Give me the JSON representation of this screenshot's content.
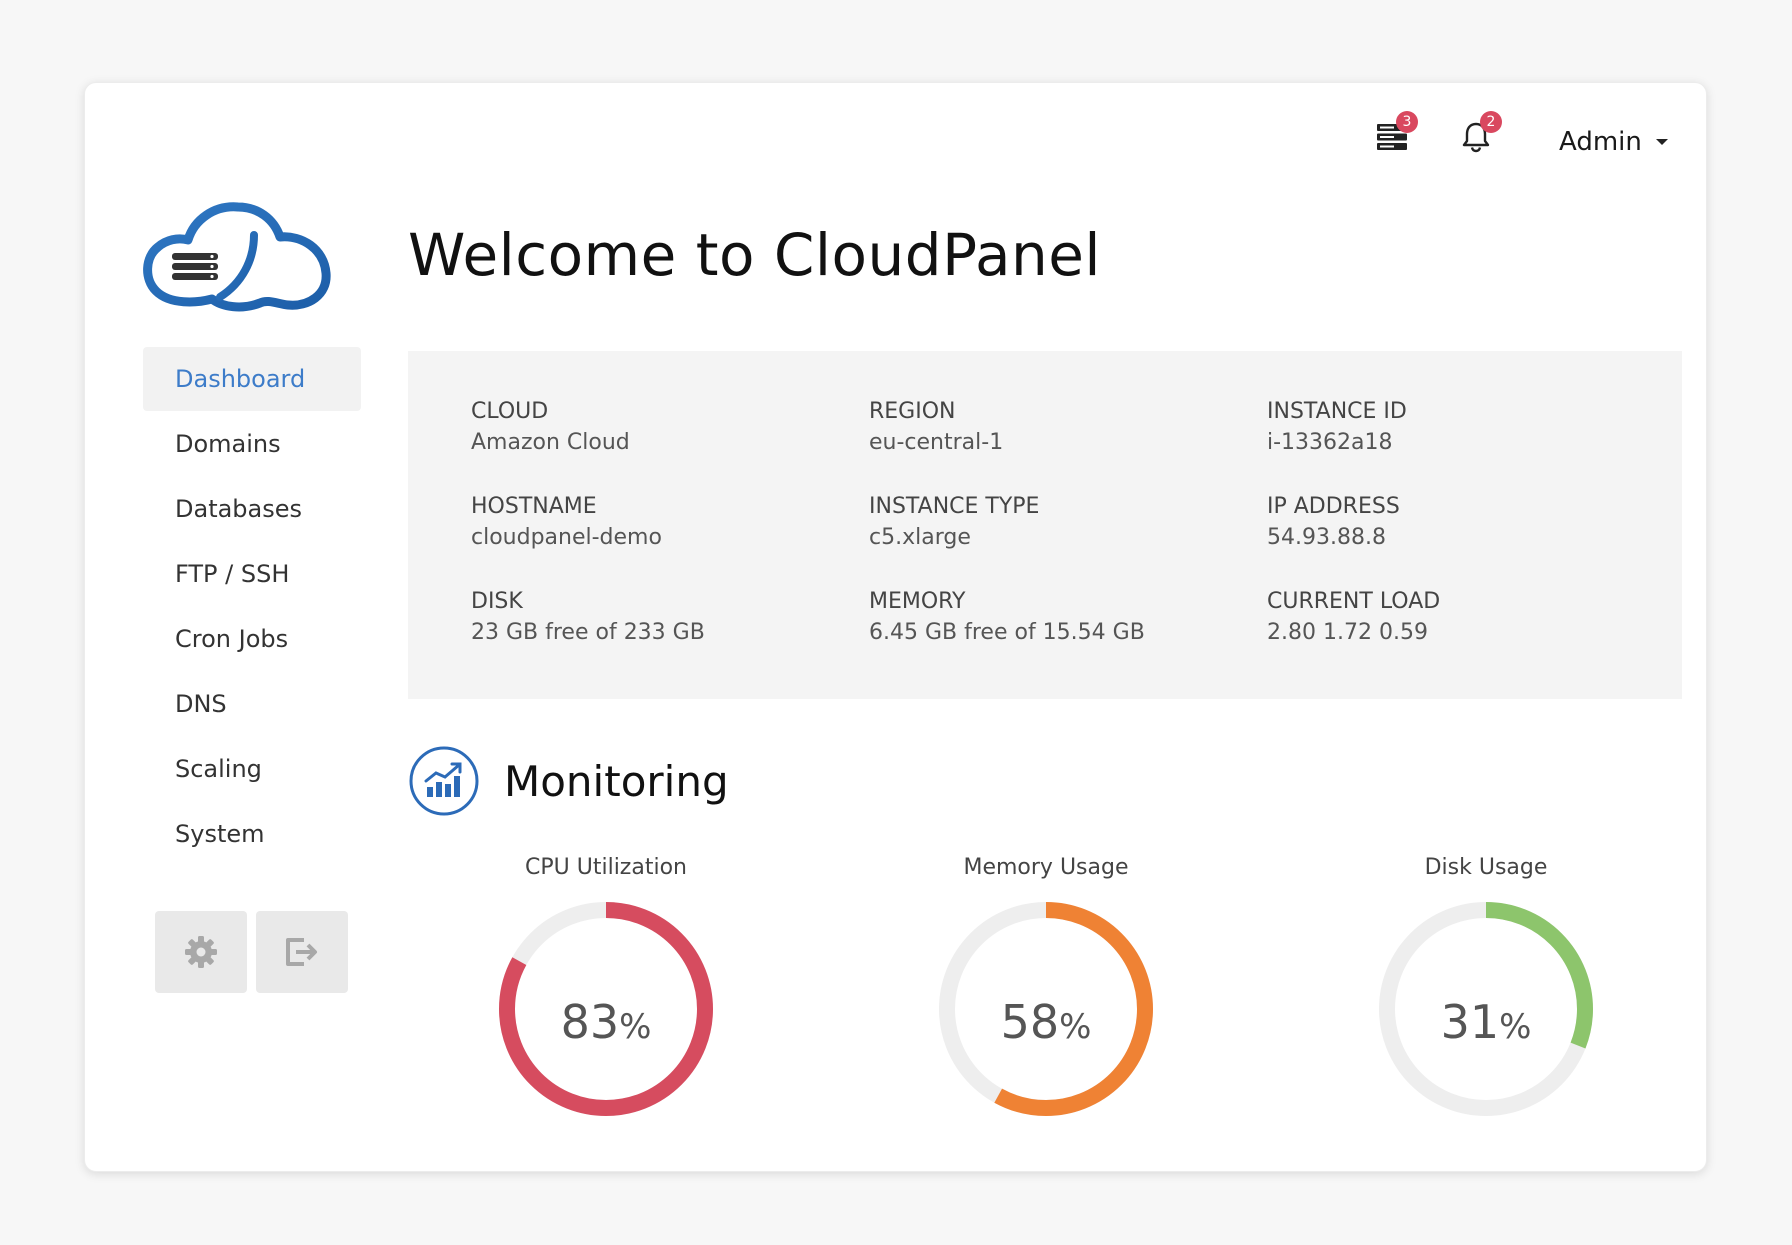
{
  "header": {
    "servers_badge": "3",
    "notifications_badge": "2",
    "user_label": "Admin",
    "badge_color": "#d9485f"
  },
  "sidebar": {
    "items": [
      {
        "label": "Dashboard",
        "active": true
      },
      {
        "label": "Domains"
      },
      {
        "label": "Databases"
      },
      {
        "label": "FTP / SSH"
      },
      {
        "label": "Cron Jobs"
      },
      {
        "label": "DNS"
      },
      {
        "label": "Scaling"
      },
      {
        "label": "System"
      }
    ],
    "buttons": [
      "gear-icon",
      "logout-icon"
    ],
    "active_color": "#3d7cc9"
  },
  "main": {
    "title": "Welcome to CloudPanel",
    "info": [
      {
        "label": "CLOUD",
        "value": "Amazon Cloud"
      },
      {
        "label": "REGION",
        "value": "eu-central-1"
      },
      {
        "label": "INSTANCE ID",
        "value": "i-13362a18"
      },
      {
        "label": "HOSTNAME",
        "value": "cloudpanel-demo"
      },
      {
        "label": "INSTANCE TYPE",
        "value": "c5.xlarge"
      },
      {
        "label": "IP ADDRESS",
        "value": "54.93.88.8"
      },
      {
        "label": "DISK",
        "value": "23 GB free of 233 GB"
      },
      {
        "label": "MEMORY",
        "value": "6.45 GB free of 15.54 GB"
      },
      {
        "label": "CURRENT LOAD",
        "value": "2.80 1.72 0.59"
      }
    ],
    "monitoring": {
      "title": "Monitoring",
      "gauges": [
        {
          "label": "CPU Utilization",
          "value": 83,
          "display": "83",
          "unit": "%",
          "color": "#d64c5f"
        },
        {
          "label": "Memory Usage",
          "value": 58,
          "display": "58",
          "unit": "%",
          "color": "#ef8234"
        },
        {
          "label": "Disk Usage",
          "value": 31,
          "display": "31",
          "unit": "%",
          "color": "#8dc56c"
        }
      ]
    }
  }
}
